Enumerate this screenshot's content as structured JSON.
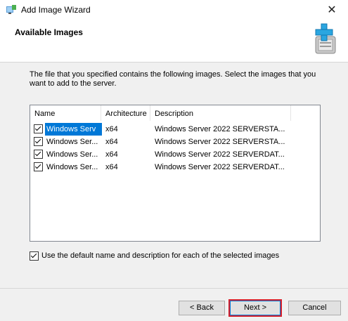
{
  "window": {
    "title": "Add Image Wizard",
    "close_glyph": "✕"
  },
  "header": {
    "title": "Available Images"
  },
  "instructions": "The file that you specified contains the following images. Select the images that you want to add to the server.",
  "table": {
    "columns": [
      "Name",
      "Architecture",
      "Description"
    ],
    "rows": [
      {
        "name": "Windows Ser...",
        "arch": "x64",
        "desc": "Windows Server 2022 SERVERSTA...",
        "checked": true
      },
      {
        "name": "Windows Ser...",
        "arch": "x64",
        "desc": "Windows Server 2022 SERVERSTA...",
        "checked": true
      },
      {
        "name": "Windows Ser...",
        "arch": "x64",
        "desc": "Windows Server 2022 SERVERDAT...",
        "checked": true
      },
      {
        "name": "Windows Ser...",
        "arch": "x64",
        "desc": "Windows Server 2022 SERVERDAT...",
        "checked": true
      }
    ]
  },
  "default_option": {
    "label": "Use the default name and description for each of the selected images",
    "checked": true
  },
  "buttons": {
    "back": "< Back",
    "next": "Next >",
    "cancel": "Cancel"
  },
  "row0_name_full": "Windows Serv",
  "colors": {
    "selection": "#0078d7",
    "highlight": "#d6202c"
  }
}
